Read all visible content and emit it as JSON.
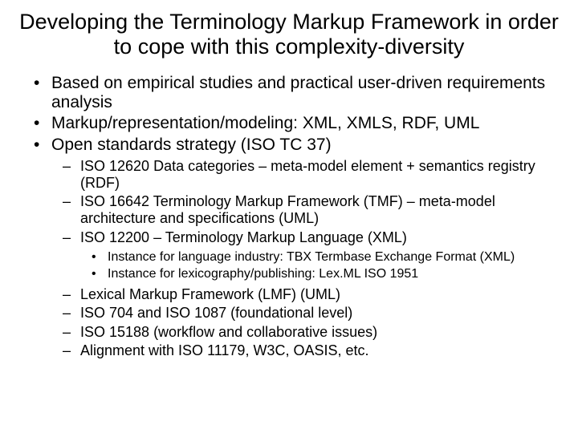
{
  "title": "Developing the Terminology Markup Framework in order to cope with this complexity-diversity",
  "bullets": [
    "Based on empirical studies and practical user-driven requirements analysis",
    "Markup/representation/modeling: XML, XMLS, RDF, UML",
    "Open standards strategy (ISO TC 37)"
  ],
  "sub": [
    "ISO 12620 Data categories – meta-model element + semantics registry (RDF)",
    "ISO 16642 Terminology Markup Framework (TMF) – meta-model architecture and specifications (UML)",
    "ISO 12200 – Terminology Markup Language (XML)"
  ],
  "subsub": [
    "Instance for language industry: TBX Termbase Exchange Format (XML)",
    "Instance for lexicography/publishing: Lex.ML ISO 1951"
  ],
  "sub2": [
    "Lexical Markup Framework (LMF) (UML)",
    "ISO 704 and ISO 1087 (foundational level)",
    "ISO 15188 (workflow and collaborative issues)",
    "Alignment with ISO 11179, W3C, OASIS, etc."
  ]
}
